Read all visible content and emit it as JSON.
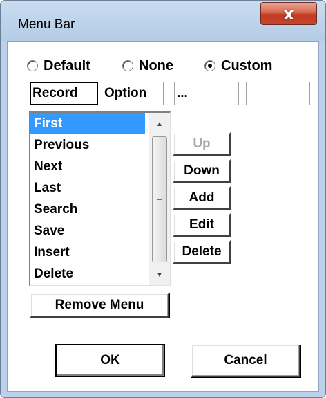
{
  "window": {
    "title": "Menu Bar",
    "close_glyph": "x"
  },
  "menu_type": {
    "options": [
      {
        "label": "Default",
        "checked": false
      },
      {
        "label": "None",
        "checked": false
      },
      {
        "label": "Custom",
        "checked": true
      }
    ]
  },
  "menus": [
    "Record",
    "Option",
    "...",
    ""
  ],
  "items": {
    "list": [
      "First",
      "Previous",
      "Next",
      "Last",
      "Search",
      "Save",
      "Insert",
      "Delete"
    ],
    "selected": "First"
  },
  "item_buttons": {
    "up": "Up",
    "down": "Down",
    "add": "Add",
    "edit": "Edit",
    "delete": "Delete"
  },
  "remove_menu": "Remove Menu",
  "dialog_buttons": {
    "ok": "OK",
    "cancel": "Cancel"
  },
  "colors": {
    "selection": "#3399ff",
    "close_button": "#c7452e"
  },
  "icons": {
    "scroll_up": "up-triangle",
    "scroll_down": "down-triangle",
    "scroll_grip": "grip-lines"
  }
}
